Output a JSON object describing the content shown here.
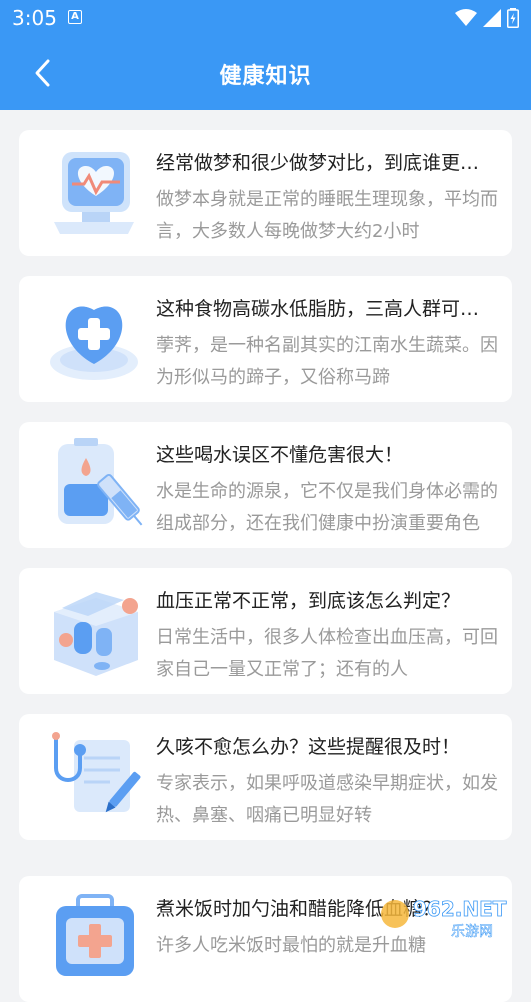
{
  "status": {
    "time": "3:05",
    "notif_icon_letter": "A"
  },
  "header": {
    "title": "健康知识",
    "back_icon": "chevron-left-icon"
  },
  "articles": [
    {
      "title": "经常做梦和很少做梦对比，到底谁更健康？",
      "desc": "做梦本身就是正常的睡眠生理现象，平均而言，大多数人每晚做梦大约2小时",
      "icon": "heart-monitor-icon"
    },
    {
      "title": "这种食物高碳水低脂肪，三高人群可以多吃",
      "desc": "荸荠，是一种名副其实的江南水生蔬菜。因为形似马的蹄子，又俗称马蹄",
      "icon": "medical-shield-icon"
    },
    {
      "title": "这些喝水误区不懂危害很大！",
      "desc": "水是生命的源泉，它不仅是我们身体必需的组成部分，还在我们健康中扮演重要角色",
      "icon": "iv-syringe-icon"
    },
    {
      "title": "血压正常不正常，到底该怎么判定？",
      "desc": "日常生活中，很多人体检查出血压高，可回家自己一量又正常了；还有的人",
      "icon": "pill-box-icon"
    },
    {
      "title": "久咳不愈怎么办？这些提醒很及时！",
      "desc": "专家表示，如果呼吸道感染早期症状，如发热、鼻塞、咽痛已明显好转",
      "icon": "stethoscope-clipboard-icon"
    },
    {
      "title": "煮米饭时加勺油和醋能降低血糖？",
      "desc": "许多人吃米饭时最怕的就是升血糖",
      "icon": "medical-kit-icon"
    }
  ],
  "watermark": {
    "text": "962.NET",
    "sub": "乐游网"
  },
  "colors": {
    "primary": "#3a98f5",
    "background": "#f2f3f5",
    "card": "#ffffff",
    "title": "#222222",
    "desc": "#9a9a9a"
  }
}
